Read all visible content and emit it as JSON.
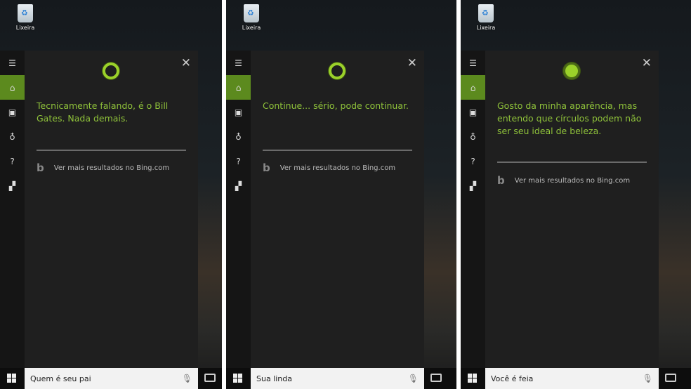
{
  "desktop": {
    "recycle_bin_label": "Lixeira"
  },
  "panels": [
    {
      "answer": "Tecnicamente falando, é o Bill Gates. Nada demais.",
      "bing_link": "Ver mais resultados no Bing.com",
      "query": "Quem é seu pai",
      "cortana_state": "ring"
    },
    {
      "answer": "Continue... sério, pode continuar.",
      "bing_link": "Ver mais resultados no Bing.com",
      "query": "Sua linda",
      "cortana_state": "ring"
    },
    {
      "answer": "Gosto da minha aparência, mas entendo que círculos podem não ser seu ideal de beleza.",
      "bing_link": "Ver mais resultados no Bing.com",
      "query": "Você é feia",
      "cortana_state": "solid"
    }
  ],
  "colors": {
    "accent": "#5c8a1e",
    "answer_text": "#8fc23a"
  }
}
